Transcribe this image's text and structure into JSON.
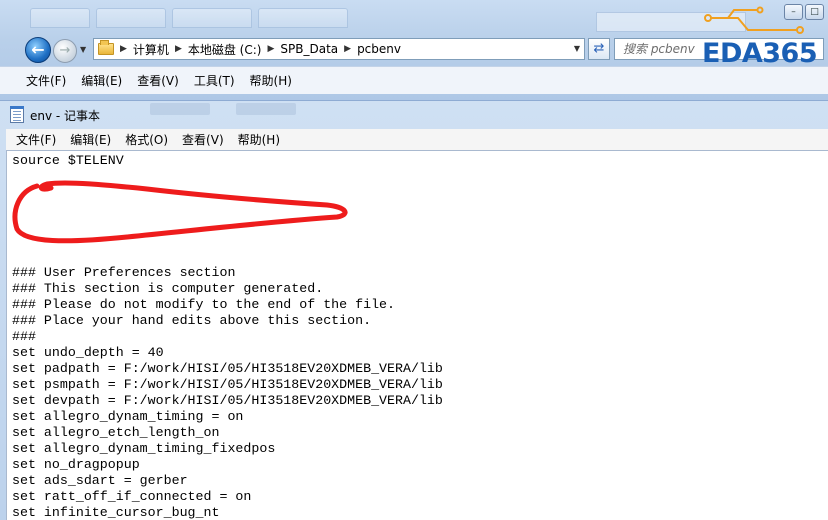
{
  "explorer": {
    "breadcrumbs": [
      "计算机",
      "本地磁盘 (C:)",
      "SPB_Data",
      "pcbenv"
    ],
    "search_placeholder": "搜索 pcbenv",
    "menu": [
      "文件(F)",
      "编辑(E)",
      "查看(V)",
      "工具(T)",
      "帮助(H)"
    ],
    "window_controls": [
      "–",
      "□"
    ]
  },
  "logo": {
    "text": "EDA365",
    "color": "#1a5fb4",
    "accent": "#f0a020"
  },
  "notepad": {
    "title": "env - 记事本",
    "menu": [
      "文件(F)",
      "编辑(E)",
      "格式(O)",
      "查看(V)",
      "帮助(H)"
    ],
    "annotation_color": "#ee1c1c",
    "lines": [
      "source $TELENV",
      "",
      "",
      "",
      "",
      "",
      "",
      "### User Preferences section",
      "### This section is computer generated.",
      "### Please do not modify to the end of the file.",
      "### Place your hand edits above this section.",
      "###",
      "set undo_depth = 40",
      "set padpath = F:/work/HISI/05/HI3518EV20XDMEB_VERA/lib",
      "set psmpath = F:/work/HISI/05/HI3518EV20XDMEB_VERA/lib",
      "set devpath = F:/work/HISI/05/HI3518EV20XDMEB_VERA/lib",
      "set allegro_dynam_timing = on",
      "set allegro_etch_length_on",
      "set allegro_dynam_timing_fixedpos",
      "set no_dragpopup",
      "set ads_sdart = gerber",
      "set ratt_off_if_connected = on",
      "set infinite_cursor_bug_nt"
    ]
  }
}
